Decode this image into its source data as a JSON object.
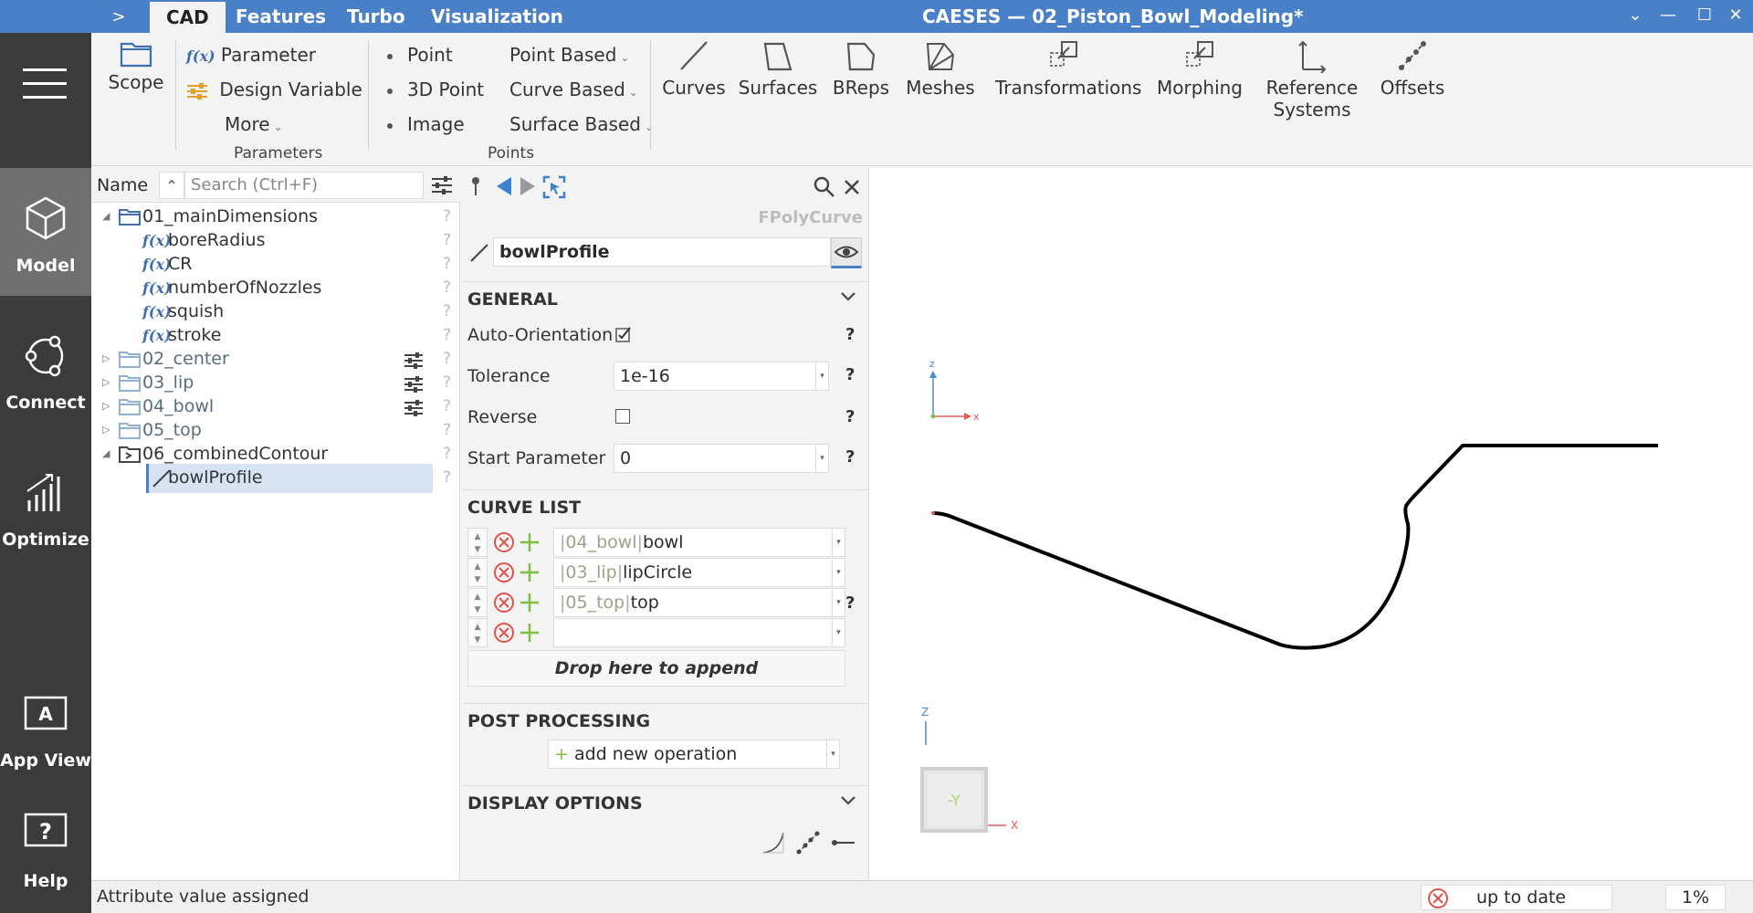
{
  "titlebar": {
    "tabs": [
      "CAD",
      "Features",
      "Turbo",
      "Visualization"
    ],
    "title": "CAESES — 02_Piston_Bowl_Modeling*",
    "sidebar_toggle": ">"
  },
  "nav": {
    "items": [
      {
        "label": "Model",
        "icon": "cube-icon"
      },
      {
        "label": "Connect",
        "icon": "connect-icon"
      },
      {
        "label": "Optimize",
        "icon": "optimize-icon"
      },
      {
        "label": "App View",
        "icon": "app-view-icon"
      },
      {
        "label": "Help",
        "icon": "help-icon"
      }
    ]
  },
  "ribbon": {
    "scope": "Scope",
    "parameter": "Parameter",
    "design_variable": "Design Variable",
    "more": "More",
    "group_parameters": "Parameters",
    "point": "Point",
    "point_3d": "3D Point",
    "image": "Image",
    "point_based": "Point Based",
    "curve_based": "Curve Based",
    "surface_based": "Surface Based",
    "group_points": "Points",
    "curves": "Curves",
    "surfaces": "Surfaces",
    "breps": "BReps",
    "meshes": "Meshes",
    "transformations": "Transformations",
    "morphing": "Morphing",
    "reference_systems_1": "Reference",
    "reference_systems_2": "Systems",
    "offsets": "Offsets",
    "fx": "f(x)"
  },
  "tree": {
    "name_header": "Name",
    "search_placeholder": "Search (Ctrl+F)",
    "items": [
      {
        "label": "01_mainDimensions"
      },
      {
        "label": "boreRadius"
      },
      {
        "label": "CR"
      },
      {
        "label": "numberOfNozzles"
      },
      {
        "label": "squish"
      },
      {
        "label": "stroke"
      },
      {
        "label": "02_center"
      },
      {
        "label": "03_lip"
      },
      {
        "label": "04_bowl"
      },
      {
        "label": "05_top"
      },
      {
        "label": "06_combinedContour"
      },
      {
        "label": "bowlProfile"
      }
    ],
    "help": "?"
  },
  "props": {
    "type": "FPolyCurve",
    "name": "bowlProfile",
    "general": "GENERAL",
    "auto_orientation": "Auto-Orientation",
    "tolerance_label": "Tolerance",
    "tolerance_value": "1e-16",
    "reverse_label": "Reverse",
    "start_param_label": "Start Parameter",
    "start_param_value": "0",
    "curve_list": "CURVE LIST",
    "curves": [
      {
        "prefix": "04_bowl",
        "name": "bowl"
      },
      {
        "prefix": "03_lip",
        "name": "lipCircle"
      },
      {
        "prefix": "05_top",
        "name": "top"
      }
    ],
    "drop_here": "Drop here to append",
    "post_processing": "POST PROCESSING",
    "add_operation": "add new operation",
    "display_options": "DISPLAY OPTIONS",
    "help": "?"
  },
  "viewport": {
    "axis_z": "z",
    "axis_x": "x",
    "cube_face": "-Y",
    "cube_z": "Z",
    "cube_x": "X"
  },
  "status": {
    "message": "Attribute value assigned",
    "state": "up to date",
    "percent": "1%"
  },
  "colors": {
    "accent": "#4a80c7",
    "sidebar": "#3b3b3b",
    "error": "#d9534f",
    "add": "#7cc242"
  }
}
